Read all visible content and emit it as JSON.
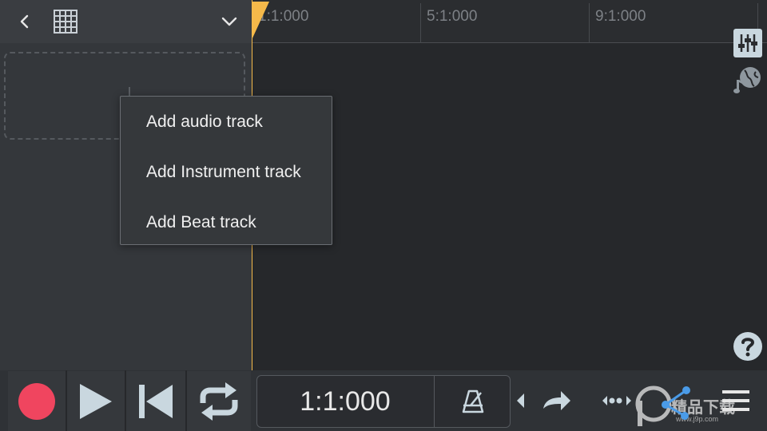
{
  "ruler": {
    "marks": [
      "1:1:000",
      "5:1:000",
      "9:1:000"
    ]
  },
  "context_menu": {
    "items": [
      "Add audio track",
      "Add Instrument track",
      "Add Beat track"
    ]
  },
  "transport": {
    "position": "1:1:000"
  },
  "watermark": {
    "brand": "精品下载",
    "url": "www.j9p.com"
  },
  "colors": {
    "accent": "#f5b94a",
    "record": "#f0455f",
    "icon": "#c9d7df",
    "panel": "#34373b",
    "timeline": "#26282b"
  },
  "icons": [
    "back-icon",
    "grid-icon",
    "chevron-down-icon",
    "mixer-icon",
    "globe-music-icon",
    "help-icon",
    "record-icon",
    "play-icon",
    "skip-back-icon",
    "loop-icon",
    "metronome-icon",
    "redo-icon",
    "move-icon",
    "share-icon",
    "menu-icon"
  ]
}
